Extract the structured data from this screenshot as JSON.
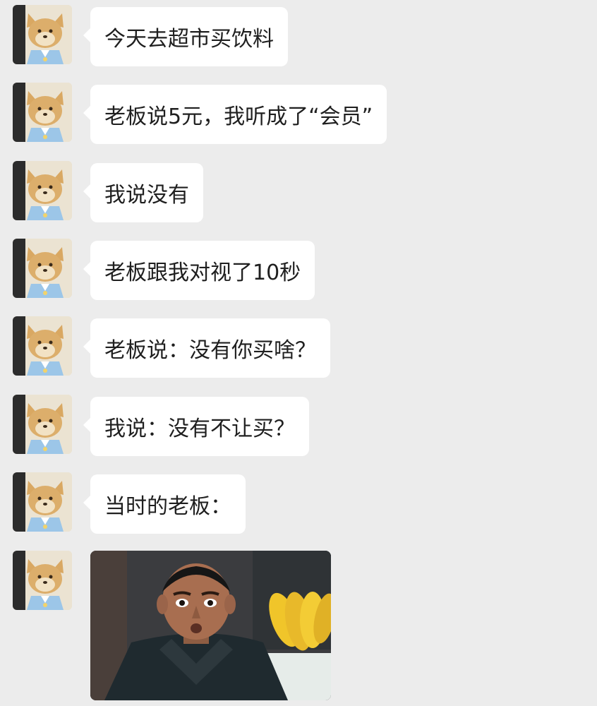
{
  "conversation": {
    "messages": [
      {
        "text": "今天去超市买饮料"
      },
      {
        "text": "老板说5元，我听成了“会员”"
      },
      {
        "text": "我说没有"
      },
      {
        "text": "老板跟我对视了10秒"
      },
      {
        "text": "老板说：没有你买啥？"
      },
      {
        "text": "我说：没有不让买？"
      },
      {
        "text": "当时的老板："
      }
    ],
    "avatar_icon": "shiba-dog-avatar-icon",
    "image_message_icon": "shocked-shopkeeper-photo-icon"
  },
  "colors": {
    "background": "#ececec",
    "bubble": "#ffffff",
    "text": "#1f1f1f"
  }
}
